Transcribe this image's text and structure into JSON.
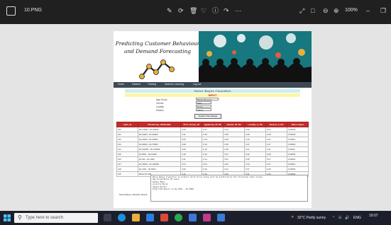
{
  "window": {
    "filename": "10.PNG",
    "zoom": "100%"
  },
  "banner": {
    "title_line1": "Predicting Customer Behaviour",
    "title_line2": "and Demand Forecasting"
  },
  "nav": {
    "items": [
      "Home",
      "Dataset",
      "Training",
      "Machine Learning",
      "Log out"
    ]
  },
  "page": {
    "heading": "Naive Bayes Classifier",
    "subheading": "INPUT",
    "form": [
      {
        "label": "Age Group",
        "value": "Below 25 years"
      },
      {
        "label": "Gender",
        "value": "Male"
      },
      {
        "label": "Locality",
        "value": "Rural"
      },
      {
        "label": "Season",
        "value": "Winter"
      }
    ],
    "predict_button": "Predict Price Range"
  },
  "table": {
    "headers": [
      "sales_id",
      "PriceGroup_Obtainable",
      "Price_Group_All",
      "AgeGroup_W_PG",
      "Gender_W_PG",
      "Locality_w_PG",
      "Season_w_PG",
      "Naive_bayes"
    ],
    "rows": [
      [
        "140",
        "Rs.0-5001 - Rs.40000",
        "0.06",
        "0.17",
        "0.44",
        "0.33",
        "0.27",
        "0.00045"
      ],
      [
        "141",
        "Rs.10001 - Rs.20000",
        "0.11",
        "0.18",
        "0.38",
        "0.40",
        "0.28",
        "0.00048"
      ],
      [
        "142",
        "Rs.20001 - Rs.30000",
        "0.06",
        "0.19",
        "0.38",
        "0.40",
        "0.22",
        "0.00010"
      ],
      [
        "143",
        "Rs.40001 - Rs.75000",
        "0.08",
        "0.19",
        "0.38",
        "0.37",
        "0.27",
        "0.00036"
      ],
      [
        "144",
        "Rs.100001 - Rs.150000",
        "0.08",
        "0.19",
        "0.38",
        "0.37",
        "0.31",
        "0.00011"
      ],
      [
        "145",
        "Rs.5001 - Rs.10000",
        "0.18",
        "0.19",
        "0.31",
        "0.39",
        "0.28",
        "0.00045"
      ],
      [
        "146",
        "Rs.301 - Rs.1000",
        "0.11",
        "0.14",
        "0.51",
        "0.35",
        "0.27",
        "0.00032"
      ],
      [
        "147",
        "Rs.75001 - Rs.100000",
        "0.01",
        "0.04",
        "0.26",
        "0.13",
        "0.27",
        "0.00001"
      ],
      [
        "148",
        "Rs.1001 - Rs.5000",
        "0.06",
        "0.16",
        "0.33",
        "0.37",
        "0.28",
        "0.00039"
      ],
      [
        "149",
        "Below Rs.300",
        "0.11",
        "0.19",
        "0.40",
        "0.31",
        "0.29",
        "0.00060"
      ]
    ]
  },
  "result": {
    "label": "Naive Bayes Classifier Result",
    "lines": [
      "Naive Bayes Classifier to predict which Price Group will be preferred by the following input values",
      "Age Group:Below 25 years",
      "Gender:Male",
      "Locality:Rural",
      "Season:Winter",
      "Predicted Result is Rs.1001 - Rs.5000"
    ]
  },
  "taskbar": {
    "search_placeholder": "Type here to search",
    "weather": "32°C  Partly sunny",
    "language": "ENG",
    "time": "19:07"
  }
}
